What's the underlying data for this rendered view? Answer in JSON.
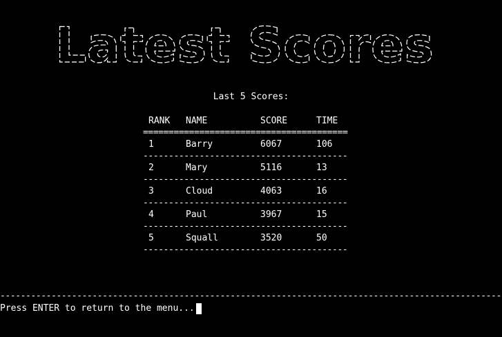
{
  "banner": {
    "title": "Latest Scores"
  },
  "subtitle": "Last 5 Scores:",
  "table": {
    "headers": {
      "rank": "RANK",
      "name": "NAME",
      "score": "SCORE",
      "time": "TIME"
    },
    "header_rule": "================================================",
    "row_rule": "------------------------------------------------",
    "rows": [
      {
        "rank": "1",
        "name": "Barry",
        "score": "6067",
        "time": "106"
      },
      {
        "rank": "2",
        "name": "Mary",
        "score": "5116",
        "time": "13"
      },
      {
        "rank": "3",
        "name": "Cloud",
        "score": "4063",
        "time": "16"
      },
      {
        "rank": "4",
        "name": "Paul",
        "score": "3967",
        "time": "15"
      },
      {
        "rank": "5",
        "name": "Squall",
        "score": "3520",
        "time": "50"
      }
    ]
  },
  "footer": {
    "rule": "-------------------------------------------------------------------------------------------------------------------------",
    "prompt": "Press ENTER to return to the menu..."
  }
}
